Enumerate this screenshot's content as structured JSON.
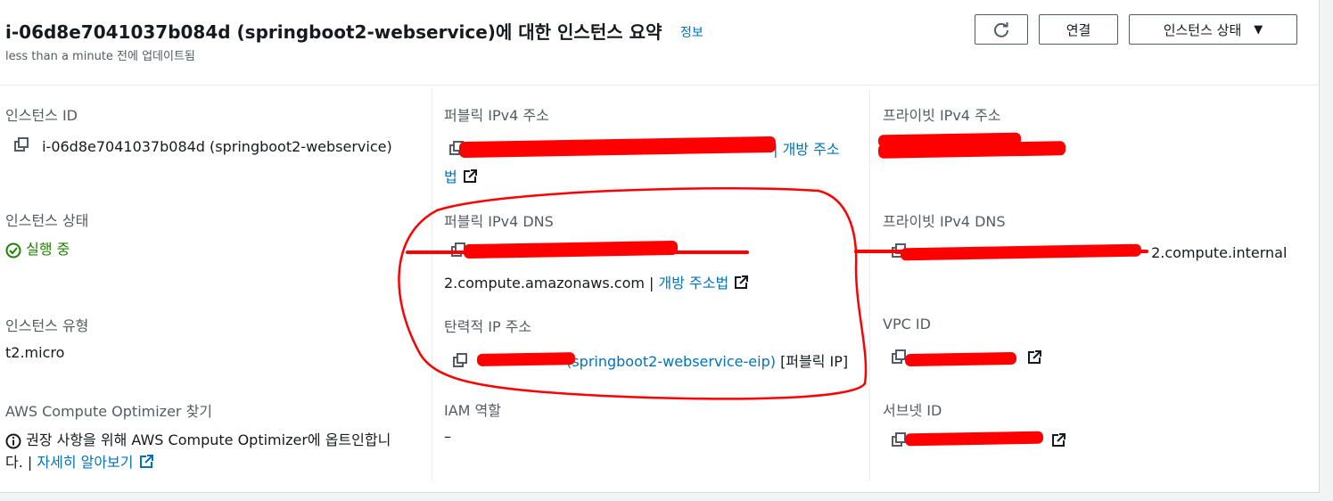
{
  "header": {
    "title": "i-06d8e7041037b084d (springboot2-webservice)에 대한 인스턴스 요약",
    "info_link": "정보",
    "updated": "less than a minute 전에 업데이트됨",
    "buttons": {
      "refresh_icon": "refresh-icon",
      "connect": "연결",
      "instance_state": "인스턴스 상태"
    }
  },
  "col1": {
    "instance_id": {
      "label": "인스턴스 ID",
      "value": "i-06d8e7041037b084d (springboot2-webservice)"
    },
    "instance_state": {
      "label": "인스턴스 상태",
      "value": "실행 중"
    },
    "instance_type": {
      "label": "인스턴스 유형",
      "value": "t2.micro"
    },
    "optimizer": {
      "label": "AWS Compute Optimizer 찾기",
      "line1": "권장 사항을 위해 AWS Compute Optimizer에 옵트인합니",
      "line2_prefix": "다. | ",
      "line2_link": "자세히 알아보기"
    }
  },
  "col2": {
    "public_ipv4": {
      "label": "퍼블릭 IPv4 주소",
      "link_part1": "| 개방 주소",
      "link_part2": "법"
    },
    "public_dns": {
      "label": "퍼블릭 IPv4 DNS",
      "value": "2.compute.amazonaws.com | ",
      "link": "개방 주소법"
    },
    "elastic_ip": {
      "label": "탄력적 IP 주소",
      "link": "(springboot2-webservice-eip)",
      "suffix": "[퍼블릭 IP]"
    },
    "iam_role": {
      "label": "IAM 역할",
      "value": "–"
    }
  },
  "col3": {
    "private_ipv4": {
      "label": "프라이빗 IPv4 주소"
    },
    "private_dns": {
      "label": "프라이빗 IPv4 DNS",
      "value": "2.compute.internal"
    },
    "vpc_id": {
      "label": "VPC ID"
    },
    "subnet_id": {
      "label": "서브넷 ID"
    }
  },
  "colors": {
    "link": "#0073bb",
    "running": "#1d8102",
    "annotation": "#ff0000"
  }
}
